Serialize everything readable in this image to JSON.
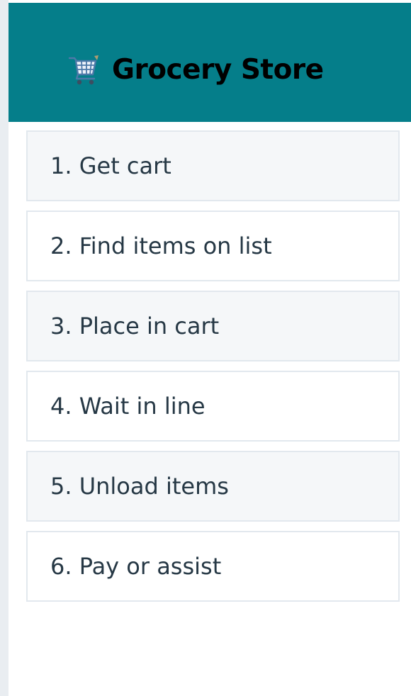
{
  "header": {
    "icon": "shopping-cart-icon",
    "title": "Grocery Store",
    "background": "#057e8a",
    "title_color": "#000000"
  },
  "steps": [
    {
      "label": "1. Get cart"
    },
    {
      "label": "2. Find items on list"
    },
    {
      "label": "3. Place in cart"
    },
    {
      "label": "4. Wait in line"
    },
    {
      "label": "5. Unload items"
    },
    {
      "label": "6. Pay or assist"
    }
  ],
  "colors": {
    "item_border": "#e2e8ee",
    "item_text": "#263845",
    "item_shaded_bg": "#f5f7f9",
    "item_plain_bg": "#ffffff"
  }
}
